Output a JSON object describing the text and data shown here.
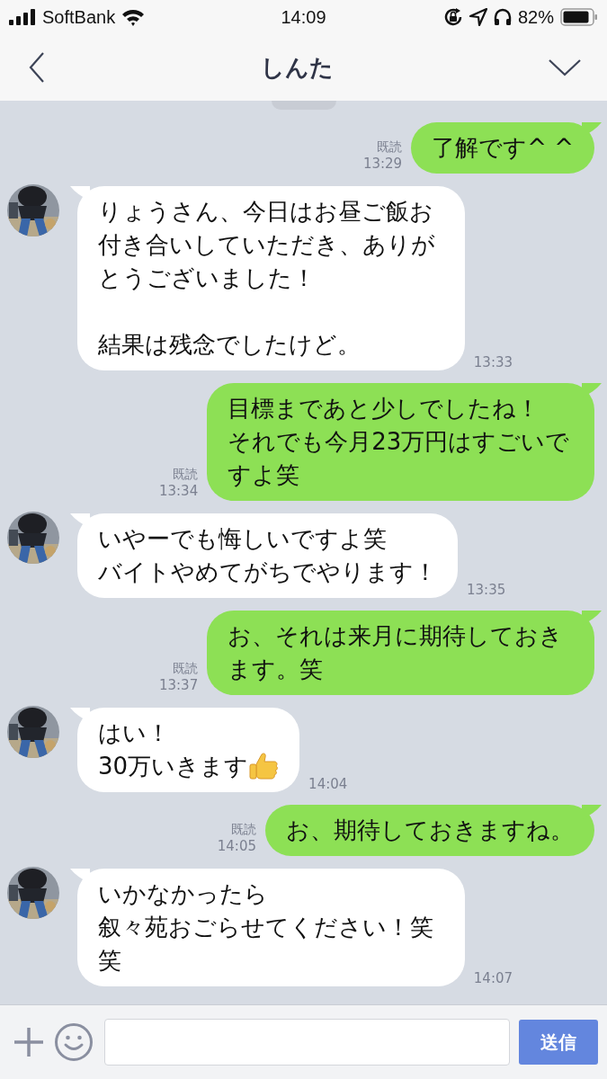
{
  "status_bar": {
    "carrier": "SoftBank",
    "time": "14:09",
    "battery": "82%"
  },
  "header": {
    "title": "しんた"
  },
  "messages": [
    {
      "kind": "sent",
      "paragraphs": [
        "了解です^ ^"
      ],
      "read": "既読",
      "time": "13:29"
    },
    {
      "kind": "received",
      "paragraphs": [
        "りょうさん、今日はお昼ご飯お付き合いしていただき、ありがとうございました！",
        "結果は残念でしたけど。"
      ],
      "blank_line_between": true,
      "time": "13:33"
    },
    {
      "kind": "sent",
      "paragraphs": [
        "目標まであと少しでしたね！",
        "それでも今月23万円はすごいですよ笑"
      ],
      "read": "既読",
      "time": "13:34"
    },
    {
      "kind": "received",
      "paragraphs": [
        "いやーでも悔しいですよ笑",
        "バイトやめてがちでやります！"
      ],
      "time": "13:35"
    },
    {
      "kind": "sent",
      "paragraphs": [
        "お、それは来月に期待しておきます。笑"
      ],
      "read": "既読",
      "time": "13:37"
    },
    {
      "kind": "received",
      "paragraphs": [
        "はい！",
        "30万いきます"
      ],
      "emoji": true,
      "time": "14:04"
    },
    {
      "kind": "sent",
      "paragraphs": [
        "お、期待しておきますね。"
      ],
      "read": "既読",
      "time": "14:05"
    },
    {
      "kind": "received",
      "paragraphs": [
        "いかなかったら",
        "叙々苑おごらせてください！笑笑"
      ],
      "time": "14:07"
    }
  ],
  "composer": {
    "send_button": "送信"
  }
}
